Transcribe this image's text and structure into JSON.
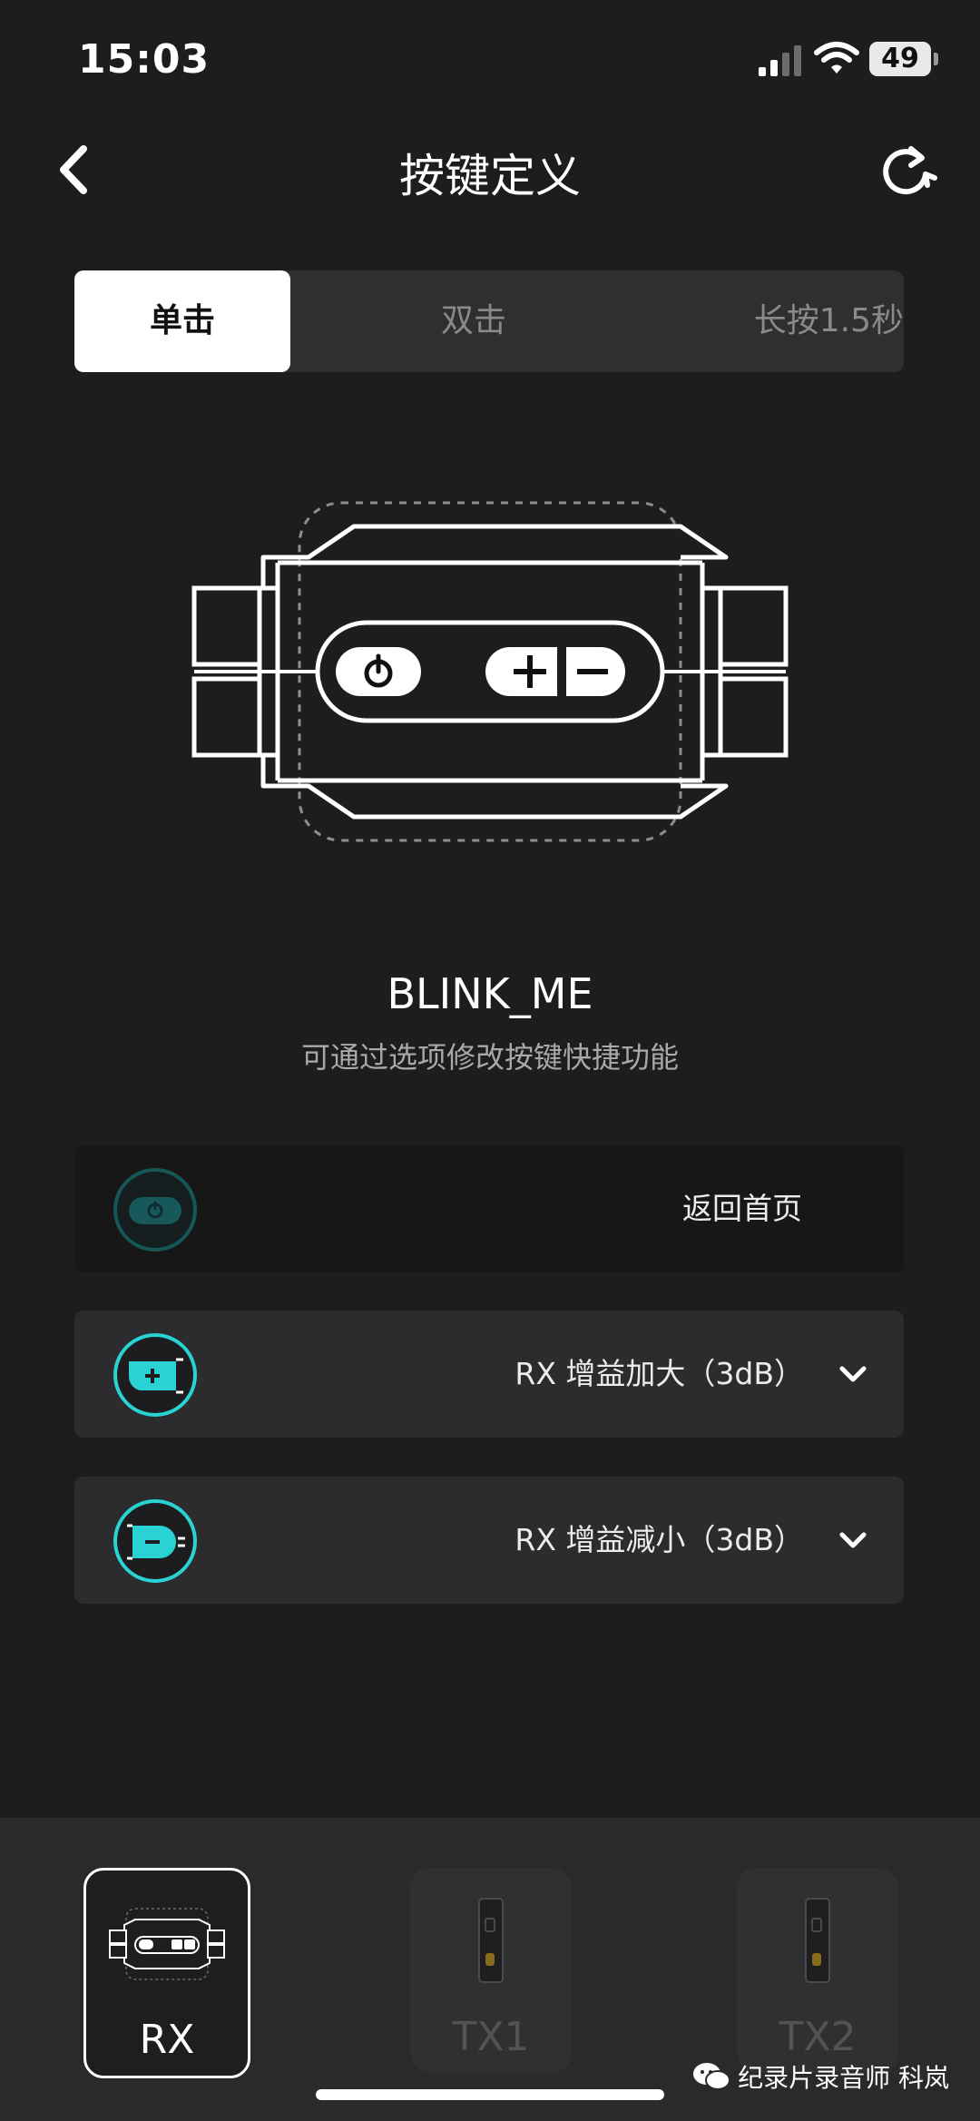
{
  "status": {
    "time": "15:03",
    "battery": "49"
  },
  "nav": {
    "title": "按键定义"
  },
  "segments": {
    "single": "单击",
    "double": "双击",
    "long_press": "长按1.5秒"
  },
  "device": {
    "name": "BLINK_ME",
    "subtitle": "可通过选项修改按键快捷功能"
  },
  "rows": [
    {
      "label": "返回首页"
    },
    {
      "label": "RX 增益加大（3dB）"
    },
    {
      "label": "RX 增益减小（3dB）"
    }
  ],
  "tabs": {
    "rx": "RX",
    "tx1": "TX1",
    "tx2": "TX2"
  },
  "watermark": "纪录片录音师 科岚",
  "colors": {
    "accent": "#2ad3d3",
    "background": "#1d1d1f"
  }
}
